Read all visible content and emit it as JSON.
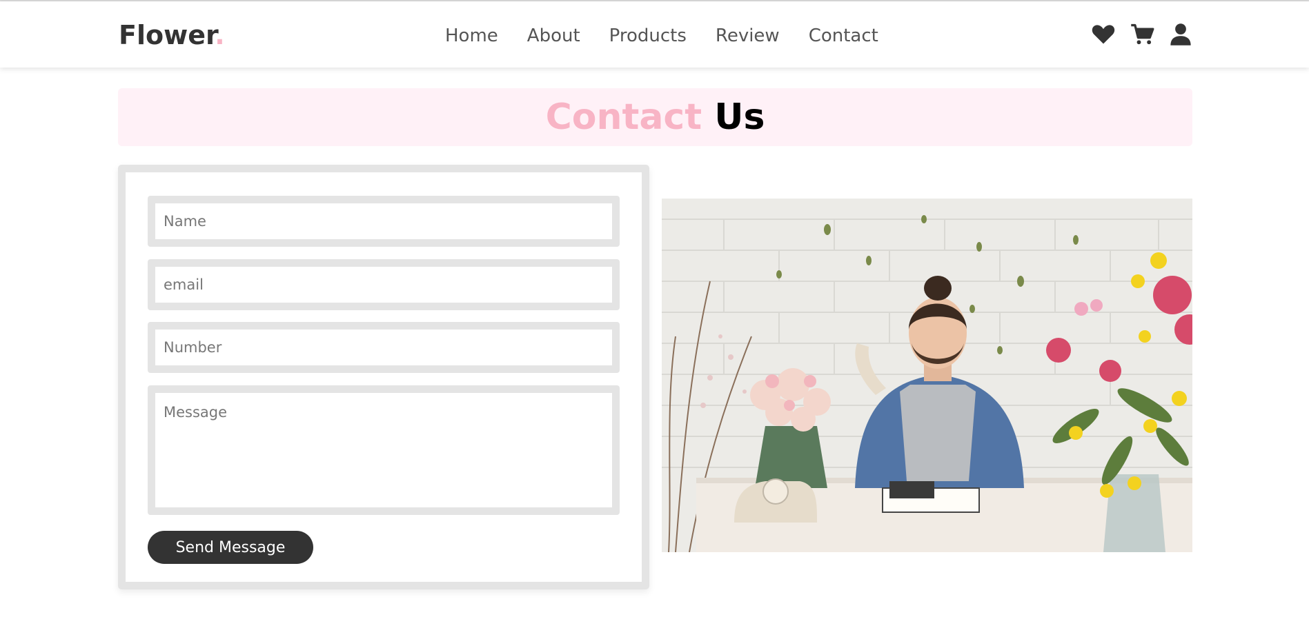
{
  "nav": {
    "logo_text": "Flower",
    "logo_dot": ".",
    "links": [
      "Home",
      "About",
      "Products",
      "Review",
      "Contact"
    ],
    "icons": [
      "heart-icon",
      "cart-icon",
      "user-icon"
    ]
  },
  "contact": {
    "heading_accent": "Contact",
    "heading_rest": "Us",
    "form": {
      "name_placeholder": "Name",
      "email_placeholder": "email",
      "number_placeholder": "Number",
      "message_placeholder": "Message",
      "submit_label": "Send Message"
    }
  },
  "colors": {
    "accent_pink": "#f8b4c5",
    "heading_band": "#fff1f7",
    "button_dark": "#333333",
    "border_gray": "#e4e4e4"
  }
}
